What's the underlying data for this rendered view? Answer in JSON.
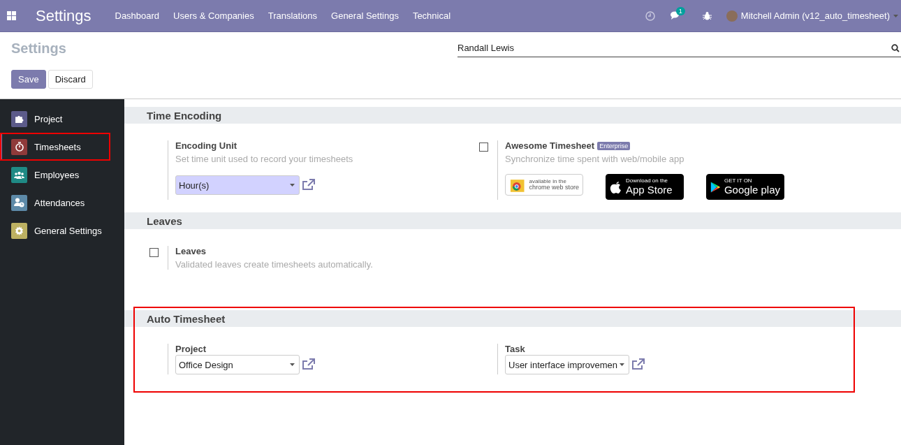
{
  "topbar": {
    "app_title": "Settings",
    "menu": [
      "Dashboard",
      "Users & Companies",
      "Translations",
      "General Settings",
      "Technical"
    ],
    "messages_count": "1",
    "user": "Mitchell Admin (v12_auto_timesheet)"
  },
  "control_panel": {
    "title": "Settings",
    "search": {
      "value": "Randall Lewis"
    },
    "buttons": [
      {
        "label": "Save",
        "kind": "primary"
      },
      {
        "label": "Discard",
        "kind": "secondary"
      }
    ]
  },
  "sidebar": {
    "items": [
      {
        "label": "Project",
        "kind": "project",
        "selected": false,
        "highlighted": false
      },
      {
        "label": "Timesheets",
        "kind": "timesheets",
        "selected": true,
        "highlighted": true
      },
      {
        "label": "Employees",
        "kind": "employees",
        "selected": false,
        "highlighted": false
      },
      {
        "label": "Attendances",
        "kind": "attendances",
        "selected": false,
        "highlighted": false
      },
      {
        "label": "General Settings",
        "kind": "general",
        "selected": false,
        "highlighted": false
      }
    ]
  },
  "sections": [
    {
      "title": "Time Encoding",
      "highlighted": false,
      "settings": [
        {
          "kind": "select",
          "label": "Encoding Unit",
          "description": "Set time unit used to record your timesheets",
          "value": "Hour(s)",
          "required": true
        },
        {
          "kind": "checkbox",
          "label": "Awesome Timesheet",
          "badge": "Enterprise",
          "description": "Synchronize time spent with web/mobile app",
          "checked": false,
          "stores": [
            {
              "kind": "chrome",
              "line1": "available in the",
              "line2": "chrome web store"
            },
            {
              "kind": "apple",
              "line1": "Download on the",
              "line2": "App Store"
            },
            {
              "kind": "google",
              "line1": "GET IT ON",
              "line2": "Google play"
            }
          ]
        }
      ]
    },
    {
      "title": "Leaves",
      "highlighted": false,
      "settings": [
        {
          "kind": "checkbox",
          "label": "Leaves",
          "description": "Validated leaves create timesheets automatically.",
          "checked": false
        }
      ]
    },
    {
      "title": "Auto Timesheet",
      "highlighted": true,
      "settings": [
        {
          "kind": "select",
          "label": "Project",
          "value": "Office Design",
          "required": false
        },
        {
          "kind": "select",
          "label": "Task",
          "value": "User interface improvemen",
          "required": false
        }
      ]
    }
  ]
}
